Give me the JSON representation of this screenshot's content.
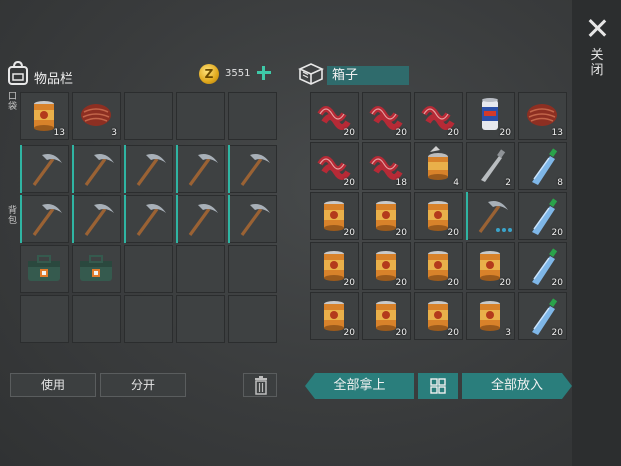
{
  "close_label": "关闭",
  "inventory": {
    "title": "物品栏",
    "coins": "3551",
    "pocket_label": "口袋",
    "backpack_label": "背包",
    "pocket_slots": [
      {
        "item": "canned-food",
        "qty": "13"
      },
      {
        "item": "steak",
        "qty": "3"
      },
      {
        "item": "",
        "qty": ""
      },
      {
        "item": "",
        "qty": ""
      },
      {
        "item": "",
        "qty": ""
      }
    ],
    "backpack_slots": [
      {
        "item": "pickaxe",
        "qty": ""
      },
      {
        "item": "pickaxe",
        "qty": ""
      },
      {
        "item": "pickaxe",
        "qty": ""
      },
      {
        "item": "pickaxe",
        "qty": ""
      },
      {
        "item": "pickaxe",
        "qty": ""
      },
      {
        "item": "pickaxe",
        "qty": ""
      },
      {
        "item": "pickaxe",
        "qty": ""
      },
      {
        "item": "pickaxe",
        "qty": ""
      },
      {
        "item": "pickaxe",
        "qty": ""
      },
      {
        "item": "pickaxe",
        "qty": ""
      },
      {
        "item": "medkit",
        "qty": ""
      },
      {
        "item": "medkit",
        "qty": ""
      },
      {
        "item": "",
        "qty": ""
      },
      {
        "item": "",
        "qty": ""
      },
      {
        "item": "",
        "qty": ""
      },
      {
        "item": "",
        "qty": ""
      },
      {
        "item": "",
        "qty": ""
      },
      {
        "item": "",
        "qty": ""
      },
      {
        "item": "",
        "qty": ""
      },
      {
        "item": "",
        "qty": ""
      }
    ],
    "use_label": "使用",
    "split_label": "分开"
  },
  "box": {
    "name": "箱子",
    "slots": [
      {
        "item": "bacon",
        "qty": "20"
      },
      {
        "item": "bacon",
        "qty": "20"
      },
      {
        "item": "bacon",
        "qty": "20"
      },
      {
        "item": "soda-can",
        "qty": "20"
      },
      {
        "item": "steak",
        "qty": "13"
      },
      {
        "item": "bacon",
        "qty": "20"
      },
      {
        "item": "bacon",
        "qty": "18"
      },
      {
        "item": "open-can",
        "qty": "4"
      },
      {
        "item": "empty-bottle",
        "qty": "2"
      },
      {
        "item": "water-bottle",
        "qty": "8"
      },
      {
        "item": "canned-food",
        "qty": "20"
      },
      {
        "item": "canned-food",
        "qty": "20"
      },
      {
        "item": "canned-food",
        "qty": "20"
      },
      {
        "item": "pickaxe",
        "qty": ""
      },
      {
        "item": "water-bottle",
        "qty": "20"
      },
      {
        "item": "canned-food",
        "qty": "20"
      },
      {
        "item": "canned-food",
        "qty": "20"
      },
      {
        "item": "canned-food",
        "qty": "20"
      },
      {
        "item": "canned-food",
        "qty": "20"
      },
      {
        "item": "water-bottle",
        "qty": "20"
      },
      {
        "item": "canned-food",
        "qty": "20"
      },
      {
        "item": "canned-food",
        "qty": "20"
      },
      {
        "item": "canned-food",
        "qty": "20"
      },
      {
        "item": "canned-food",
        "qty": "3"
      },
      {
        "item": "water-bottle",
        "qty": "20"
      }
    ],
    "take_all_label": "全部拿上",
    "put_all_label": "全部放入"
  },
  "colors": {
    "accent": "#2a7e7c",
    "highlight": "#2fb5a3",
    "coin": "#e0a81c"
  }
}
